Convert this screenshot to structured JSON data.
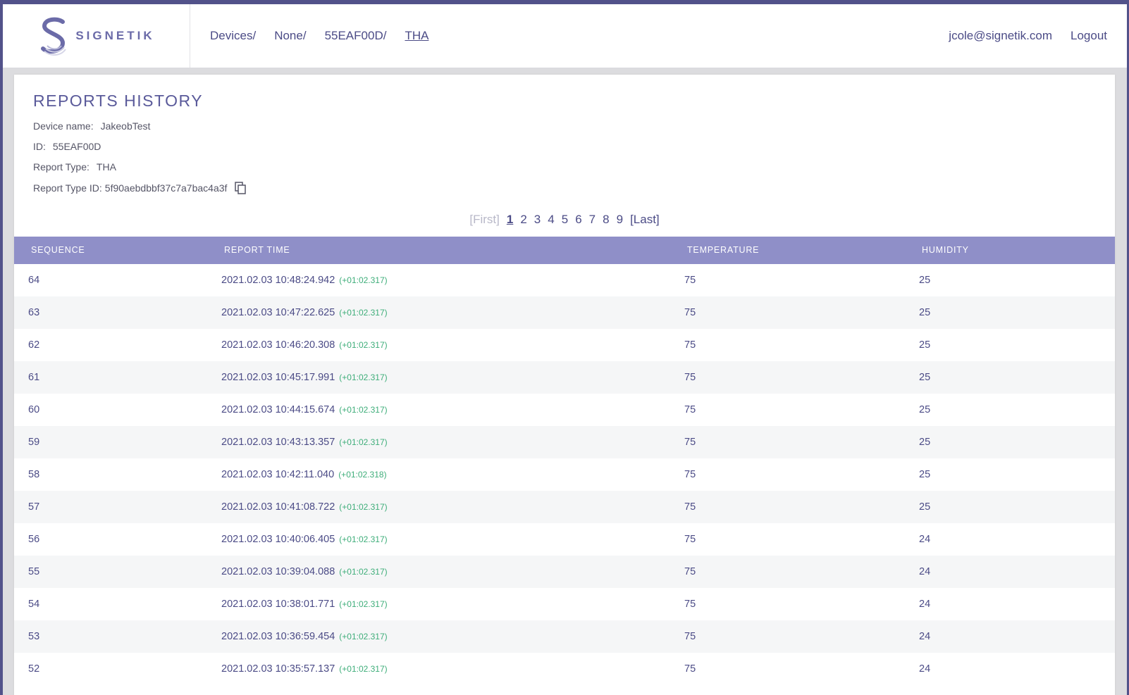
{
  "header": {
    "logo_text": "SIGNETIK",
    "breadcrumb": [
      "Devices/",
      "None/",
      "55EAF00D/",
      "THA"
    ],
    "user_email": "jcole@signetik.com",
    "logout_label": "Logout"
  },
  "page": {
    "title": "REPORTS HISTORY",
    "device_name_label": "Device name:",
    "device_name": "JakeobTest",
    "id_label": "ID:",
    "id": "55EAF00D",
    "report_type_label": "Report Type:",
    "report_type": "THA",
    "report_type_id_label": "Report Type ID:",
    "report_type_id": "5f90aebdbbf37c7a7bac4a3f"
  },
  "pager": {
    "first": "[First]",
    "pages": [
      "1",
      "2",
      "3",
      "4",
      "5",
      "6",
      "7",
      "8",
      "9"
    ],
    "current": "1",
    "last": "[Last]"
  },
  "table": {
    "headers": [
      "SEQUENCE",
      "REPORT TIME",
      "TEMPERATURE",
      "HUMIDITY"
    ],
    "rows": [
      {
        "seq": "64",
        "time": "2021.02.03 10:48:24.942",
        "delta": "(+01:02.317)",
        "temp": "75",
        "hum": "25"
      },
      {
        "seq": "63",
        "time": "2021.02.03 10:47:22.625",
        "delta": "(+01:02.317)",
        "temp": "75",
        "hum": "25"
      },
      {
        "seq": "62",
        "time": "2021.02.03 10:46:20.308",
        "delta": "(+01:02.317)",
        "temp": "75",
        "hum": "25"
      },
      {
        "seq": "61",
        "time": "2021.02.03 10:45:17.991",
        "delta": "(+01:02.317)",
        "temp": "75",
        "hum": "25"
      },
      {
        "seq": "60",
        "time": "2021.02.03 10:44:15.674",
        "delta": "(+01:02.317)",
        "temp": "75",
        "hum": "25"
      },
      {
        "seq": "59",
        "time": "2021.02.03 10:43:13.357",
        "delta": "(+01:02.317)",
        "temp": "75",
        "hum": "25"
      },
      {
        "seq": "58",
        "time": "2021.02.03 10:42:11.040",
        "delta": "(+01:02.318)",
        "temp": "75",
        "hum": "25"
      },
      {
        "seq": "57",
        "time": "2021.02.03 10:41:08.722",
        "delta": "(+01:02.317)",
        "temp": "75",
        "hum": "25"
      },
      {
        "seq": "56",
        "time": "2021.02.03 10:40:06.405",
        "delta": "(+01:02.317)",
        "temp": "75",
        "hum": "24"
      },
      {
        "seq": "55",
        "time": "2021.02.03 10:39:04.088",
        "delta": "(+01:02.317)",
        "temp": "75",
        "hum": "24"
      },
      {
        "seq": "54",
        "time": "2021.02.03 10:38:01.771",
        "delta": "(+01:02.317)",
        "temp": "75",
        "hum": "24"
      },
      {
        "seq": "53",
        "time": "2021.02.03 10:36:59.454",
        "delta": "(+01:02.317)",
        "temp": "75",
        "hum": "24"
      },
      {
        "seq": "52",
        "time": "2021.02.03 10:35:57.137",
        "delta": "(+01:02.317)",
        "temp": "75",
        "hum": "24"
      }
    ]
  },
  "colors": {
    "accent": "#8f8fc8",
    "frame": "#52528a",
    "text": "#4b4b86",
    "delta": "#3fae7a"
  },
  "icons": {
    "logo": "signetik-logo-icon",
    "copy": "copy-icon"
  }
}
